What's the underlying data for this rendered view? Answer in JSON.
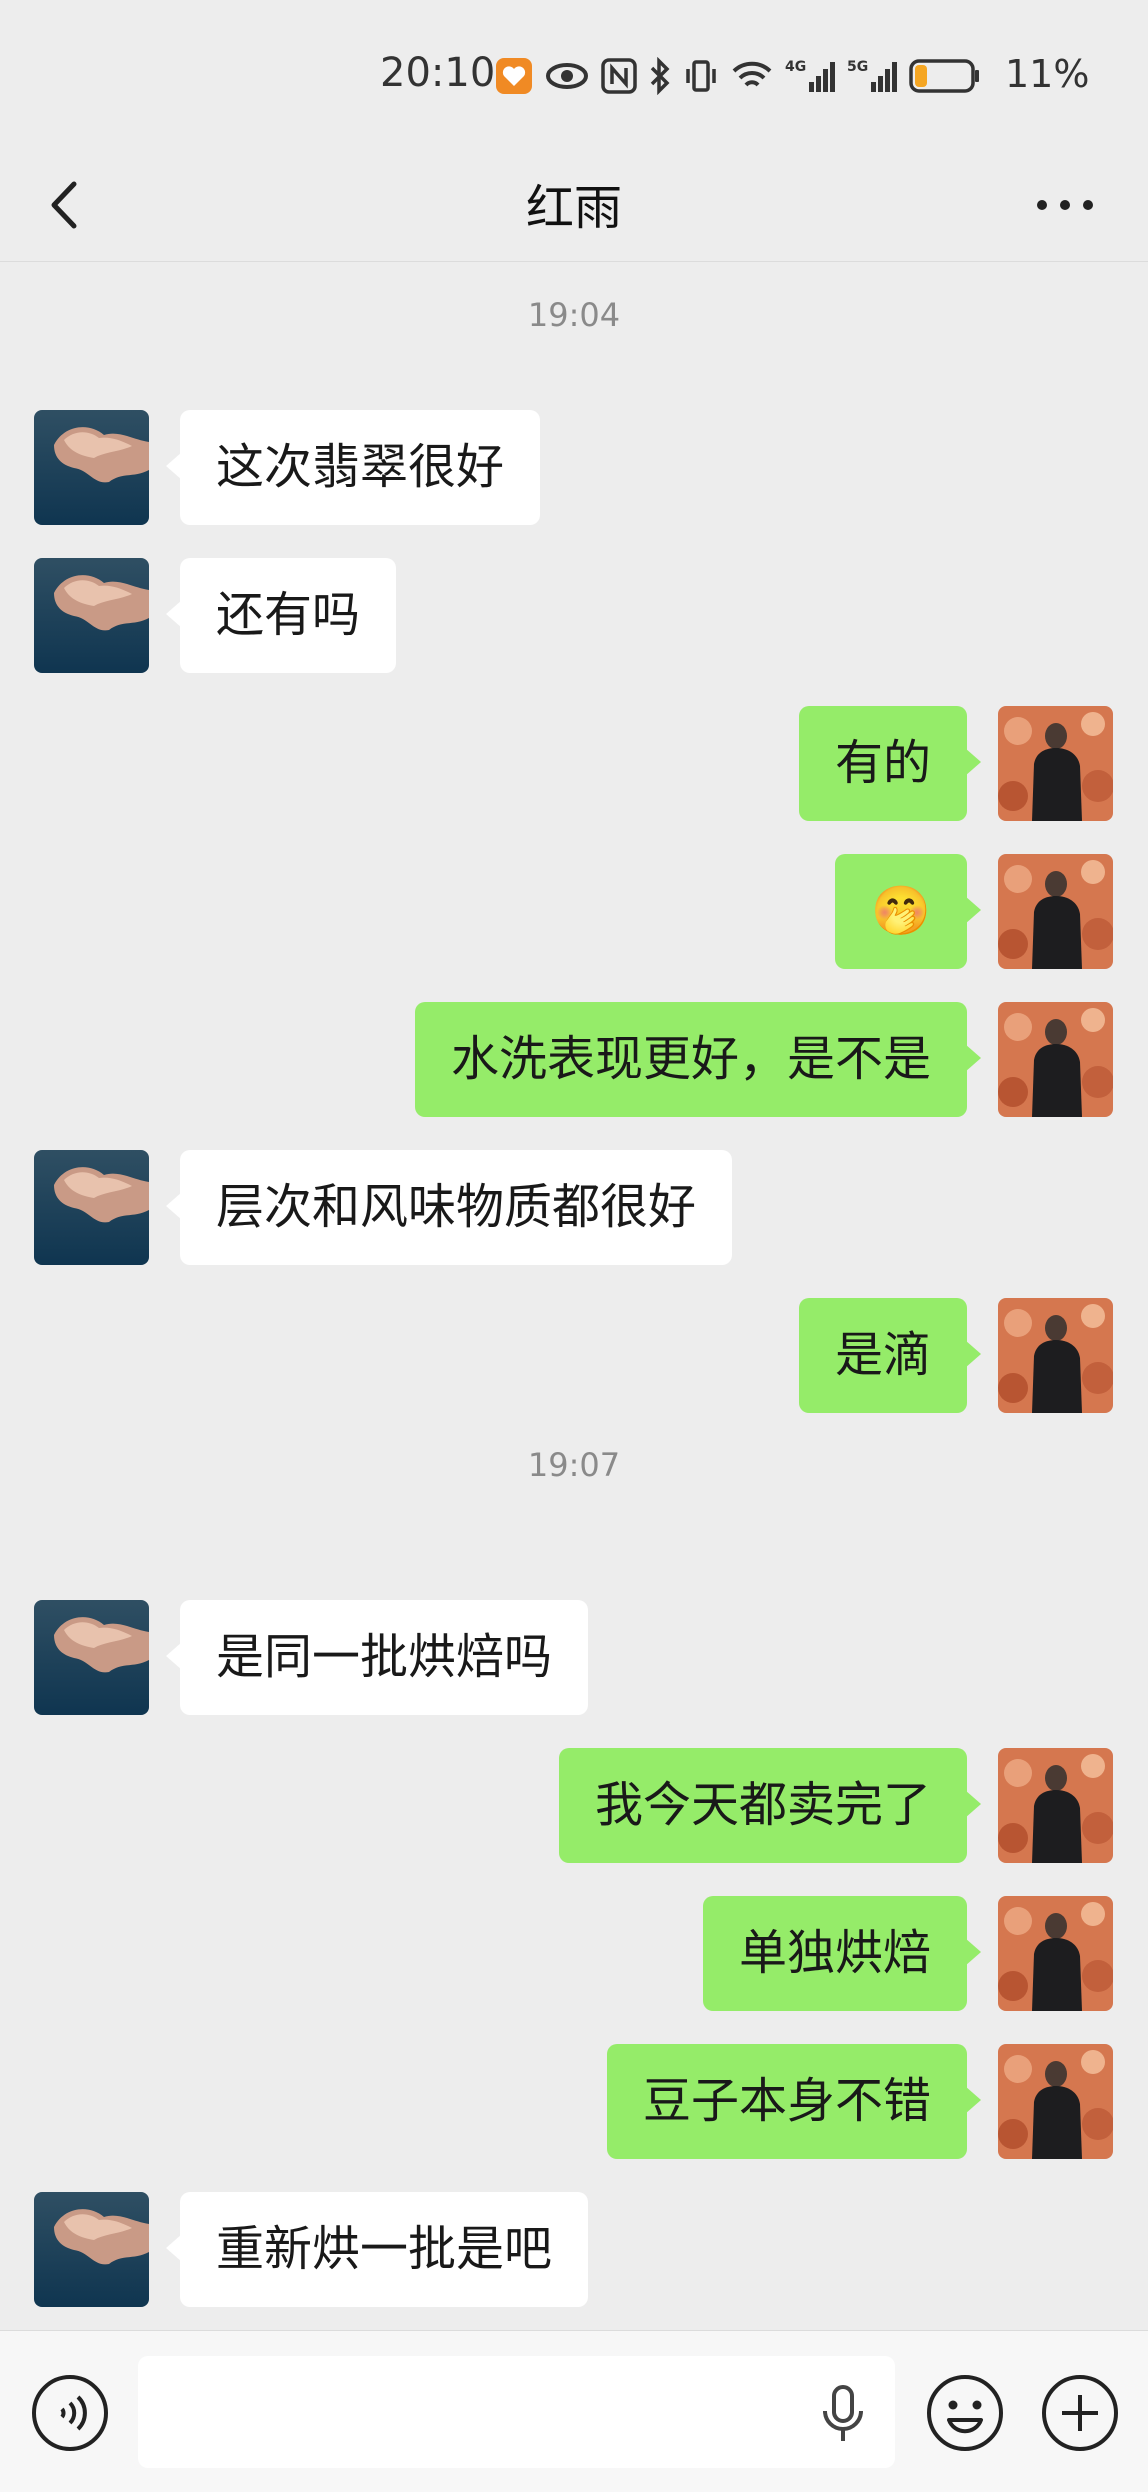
{
  "status_bar": {
    "time": "20:10",
    "icons": [
      "health-icon",
      "eye-icon",
      "nfc-icon",
      "bluetooth-icon",
      "vibrate-icon",
      "wifi-icon",
      "signal-4g-icon",
      "signal-5g-icon",
      "battery-icon"
    ],
    "battery_text": "11%",
    "battery_level": 0.11,
    "battery_color": "#f5a623"
  },
  "header": {
    "title": "红雨",
    "back_icon": "chevron-left-icon",
    "more_icon": "more-dots-icon"
  },
  "colors": {
    "background": "#ededed",
    "incoming_bubble": "#ffffff",
    "outgoing_bubble": "#95ec69",
    "timestamp": "#8a8a8a"
  },
  "messages": [
    {
      "type": "time",
      "text": "19:04"
    },
    {
      "type": "msg",
      "side": "in",
      "text": "这次翡翠很好"
    },
    {
      "type": "msg",
      "side": "in",
      "text": "还有吗"
    },
    {
      "type": "msg",
      "side": "out",
      "text": "有的"
    },
    {
      "type": "msg",
      "side": "out",
      "text": "🤭"
    },
    {
      "type": "msg",
      "side": "out",
      "text": "水洗表现更好，是不是"
    },
    {
      "type": "msg",
      "side": "in",
      "text": "层次和风味物质都很好"
    },
    {
      "type": "msg",
      "side": "out",
      "text": "是滴"
    },
    {
      "type": "time",
      "text": "19:07"
    },
    {
      "type": "msg",
      "side": "in",
      "text": "是同一批烘焙吗"
    },
    {
      "type": "msg",
      "side": "out",
      "text": "我今天都卖完了"
    },
    {
      "type": "msg",
      "side": "out",
      "text": "单独烘焙"
    },
    {
      "type": "msg",
      "side": "out",
      "text": "豆子本身不错"
    },
    {
      "type": "msg",
      "side": "in",
      "text": "重新烘一批是吧"
    }
  ],
  "input_bar": {
    "voice_icon": "voice-input-icon",
    "text_value": "",
    "mic_icon": "microphone-icon",
    "emoji_icon": "emoji-icon",
    "plus_icon": "plus-icon"
  }
}
